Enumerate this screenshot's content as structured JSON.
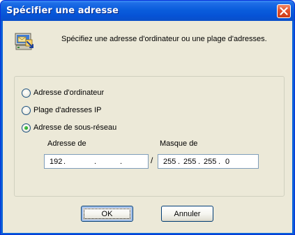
{
  "window": {
    "title": "Spécifier une adresse"
  },
  "header": {
    "description": "Spécifiez une adresse d'ordinateur ou une plage d'adresses."
  },
  "options": [
    {
      "label": "Adresse d'ordinateur",
      "selected": false
    },
    {
      "label": "Plage d'adresses IP",
      "selected": false
    },
    {
      "label": "Adresse de sous-réseau",
      "selected": true
    }
  ],
  "subnet": {
    "address_label": "Adresse de",
    "mask_label": "Masque de",
    "separator": "/",
    "address_octets": [
      "192",
      "",
      "",
      ""
    ],
    "mask_octets": [
      "255",
      "255",
      "255",
      "0"
    ],
    "dot": "."
  },
  "buttons": {
    "ok": "OK",
    "cancel": "Annuler"
  },
  "colors": {
    "titlebar": "#0a5ddc",
    "dialog_bg": "#ece9d8",
    "close_button": "#e2512b",
    "radio_dot": "#21a121"
  }
}
